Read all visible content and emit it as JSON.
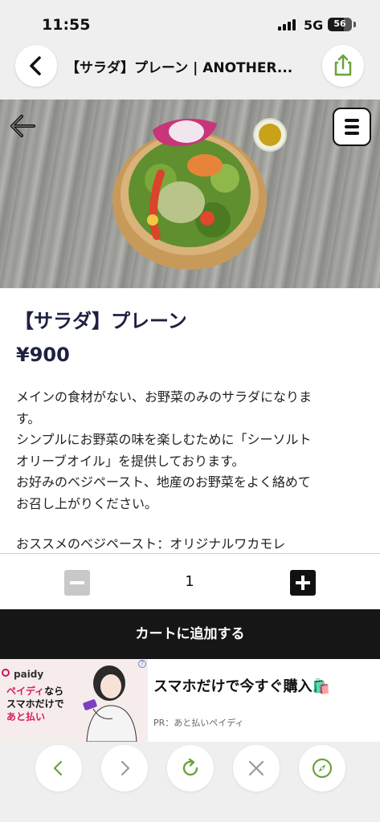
{
  "status_bar": {
    "time": "11:55",
    "network": "5G",
    "battery": "56"
  },
  "browser": {
    "page_title": "【サラダ】プレーン | ANOTHER..."
  },
  "product": {
    "name": "【サラダ】プレーン",
    "price": "¥900",
    "description": [
      "メインの食材がない、お野菜のみのサラダになりま",
      "す。",
      "シンプルにお野菜の味を楽しむために「シーソルト",
      "オリーブオイル」を提供しております。",
      "お好みのベジペースト、地産のお野菜をよく絡めて",
      "お召し上がりください。",
      ""
    ],
    "recommend": "おススメのベジペースト：オリジナルワカモレ"
  },
  "quantity": {
    "value": "1"
  },
  "cart": {
    "add_label": "カートに追加する"
  },
  "ad": {
    "brand": "paidy",
    "copy_line1_pink": "ペイディ",
    "copy_line1_rest": "なら",
    "copy_line2": "スマホだけで",
    "copy_line3": "あと払い",
    "headline": "スマホだけで今すぐ購入🛍️",
    "sub": "PR：あと払いペイディ",
    "info": "?"
  },
  "icons": {
    "back": "chevron-left-icon",
    "share": "share-icon",
    "menu": "hamburger-icon",
    "reload": "reload-icon",
    "close": "close-icon",
    "compass": "compass-icon"
  },
  "colors": {
    "accent_green": "#6aa33a",
    "title_navy": "#1e2240",
    "cart_black": "#161616",
    "paidy_pink": "#d81b60"
  }
}
